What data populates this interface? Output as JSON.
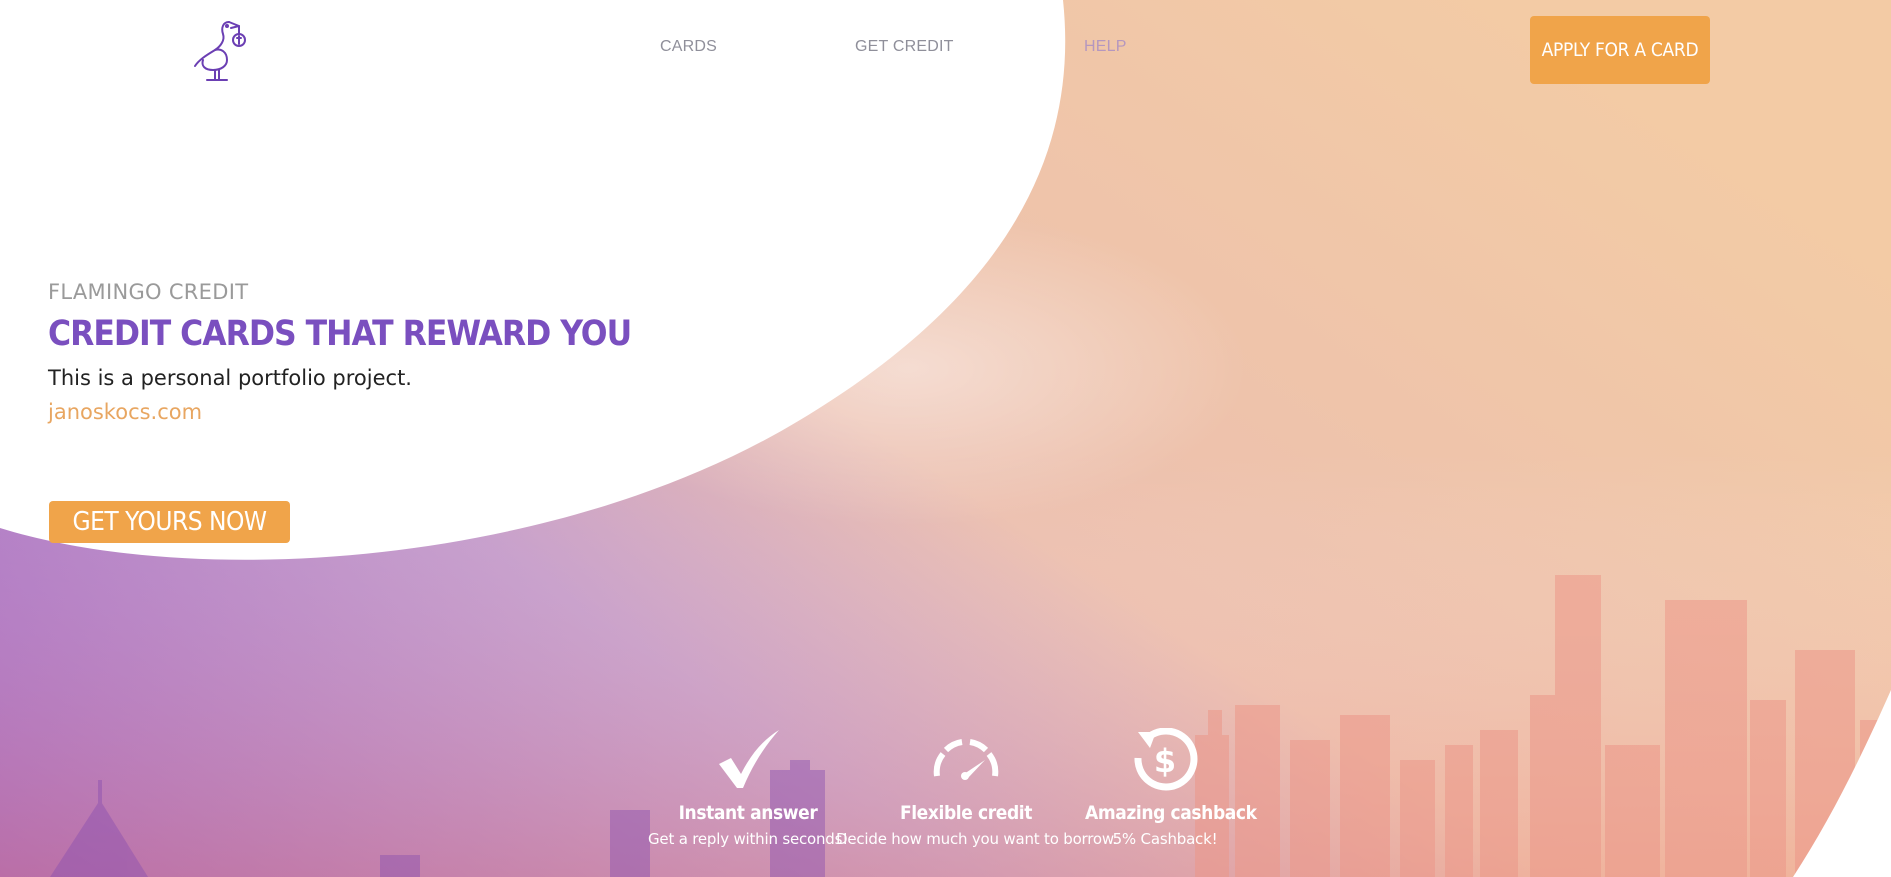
{
  "nav": {
    "items": [
      {
        "label": "CARDS"
      },
      {
        "label": "GET CREDIT"
      },
      {
        "label": "HELP"
      }
    ],
    "apply_button": "APPLY FOR A CARD"
  },
  "logo": {
    "icon": "stork-icon"
  },
  "hero": {
    "eyebrow": "FLAMINGO CREDIT",
    "headline": "CREDIT CARDS THAT REWARD YOU",
    "subtitle": "This is a personal portfolio project.",
    "link": "janoskocs.com",
    "cta": "GET YOURS NOW"
  },
  "features": [
    {
      "icon": "checkmark-icon",
      "title": "Instant answer",
      "description": "Get a reply within seconds!"
    },
    {
      "icon": "speedometer-icon",
      "title": "Flexible credit",
      "description": "Decide how much you want to borrow."
    },
    {
      "icon": "dollar-refresh-icon",
      "title": "Amazing cashback",
      "description": "5% Cashback!"
    }
  ],
  "colors": {
    "accent": "#f0a44a",
    "headline": "#7a4fbf",
    "purple_bg": "#9b5cc0",
    "peach_bg": "#f2c8a2",
    "link": "#e8a661"
  }
}
